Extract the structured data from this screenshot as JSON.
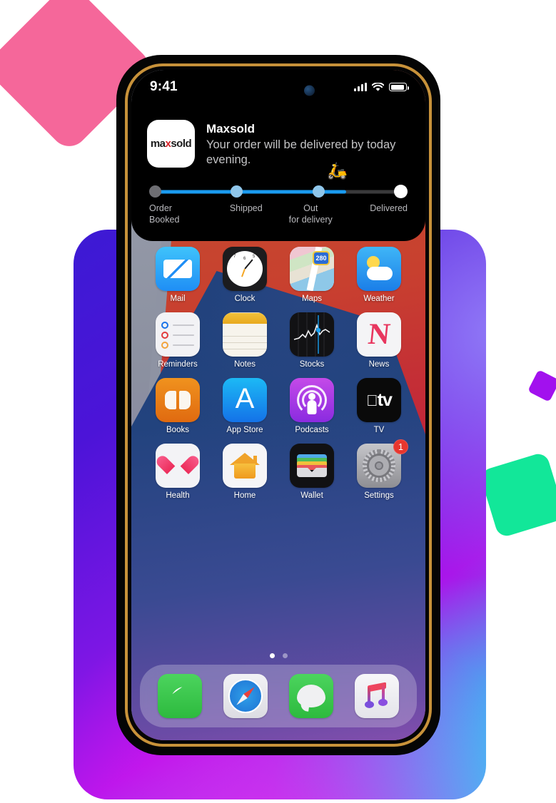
{
  "shapes": {
    "pink": "#f5679a",
    "purple": "#a211ee",
    "green": "#12e799",
    "card_gradient_from": "#3c1ad4",
    "card_gradient_to": "#3ec5f0"
  },
  "device": {
    "frame_color": "#050505",
    "accent_rim_color": "#c8923a"
  },
  "status_bar": {
    "time": "9:41",
    "signal_icon": "cellular-bars-icon",
    "wifi_icon": "wifi-icon",
    "battery_icon": "battery-icon"
  },
  "notification": {
    "app_icon_name": "maxsold-app-icon",
    "logo_prefix": "ma",
    "logo_accent": "x",
    "logo_suffix": "sold",
    "logo_accent_color": "#d8232a",
    "title": "Maxsold",
    "body": "Your order will be delivered by today evening.",
    "tracker": {
      "scooter_icon": "🛵",
      "progress_percent": 74,
      "fill_color": "#1a9bf0",
      "track_color": "#3a3a3c",
      "steps": [
        {
          "label": "Order\nBooked",
          "line1": "Order",
          "line2": "Booked",
          "state": "done"
        },
        {
          "label": "Shipped",
          "line1": "Shipped",
          "line2": "",
          "state": "done"
        },
        {
          "label": "Out for delivery",
          "line1": "Out",
          "line2": "for delivery",
          "state": "current"
        },
        {
          "label": "Delivered",
          "line1": "Delivered",
          "line2": "",
          "state": "pending"
        }
      ]
    }
  },
  "home_screen": {
    "rows": [
      [
        {
          "label": "Mail",
          "icon": "mail-icon",
          "badge": null
        },
        {
          "label": "Clock",
          "icon": "clock-icon",
          "badge": null
        },
        {
          "label": "Maps",
          "icon": "maps-icon",
          "badge": null
        },
        {
          "label": "Weather",
          "icon": "weather-icon",
          "badge": null
        }
      ],
      [
        {
          "label": "Reminders",
          "icon": "reminders-icon",
          "badge": null
        },
        {
          "label": "Notes",
          "icon": "notes-icon",
          "badge": null
        },
        {
          "label": "Stocks",
          "icon": "stocks-icon",
          "badge": null
        },
        {
          "label": "News",
          "icon": "news-icon",
          "badge": null
        }
      ],
      [
        {
          "label": "Books",
          "icon": "books-icon",
          "badge": null
        },
        {
          "label": "App Store",
          "icon": "app-store-icon",
          "badge": null
        },
        {
          "label": "Podcasts",
          "icon": "podcasts-icon",
          "badge": null
        },
        {
          "label": "TV",
          "icon": "tv-icon",
          "badge": null
        }
      ],
      [
        {
          "label": "Health",
          "icon": "health-icon",
          "badge": null
        },
        {
          "label": "Home",
          "icon": "home-icon",
          "badge": null
        },
        {
          "label": "Wallet",
          "icon": "wallet-icon",
          "badge": null
        },
        {
          "label": "Settings",
          "icon": "settings-icon",
          "badge": "1"
        }
      ]
    ],
    "maps_shield_label": "280",
    "clock_numerals": [
      "7",
      "6",
      "5"
    ],
    "tv_label": "tv",
    "news_glyph": "N",
    "app_store_glyph": "A",
    "page_dots": {
      "total": 2,
      "active_index": 0
    },
    "badge_color": "#e8362e",
    "dock": [
      {
        "label": "Phone",
        "icon": "phone-icon"
      },
      {
        "label": "Safari",
        "icon": "safari-icon"
      },
      {
        "label": "Messages",
        "icon": "messages-icon"
      },
      {
        "label": "Music",
        "icon": "music-icon"
      }
    ]
  }
}
